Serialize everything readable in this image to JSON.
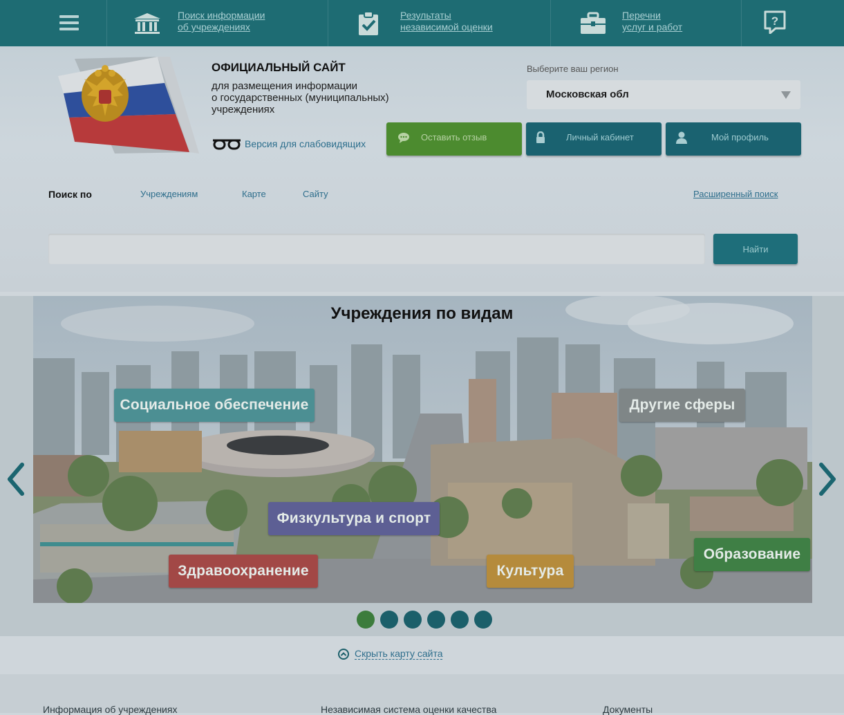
{
  "topnav": {
    "menu_icon": "hamburger-icon",
    "links": [
      {
        "line1": "Поиск информации",
        "line2": "об учреждениях",
        "icon": "institution-icon"
      },
      {
        "line1": "Результаты",
        "line2": "независимой оценки",
        "icon": "clipboard-check-icon"
      },
      {
        "line1": "Перечни",
        "line2": "услуг и работ",
        "icon": "briefcase-icon"
      }
    ],
    "help_icon": "help-question-icon"
  },
  "header": {
    "title": "ОФИЦИАЛЬНЫЙ САЙТ",
    "subtitle_lines": [
      "для размещения информации",
      "о государственных (муниципальных)",
      "учреждениях"
    ],
    "low_vision": "Версия для слабовидящих",
    "region_label": "Выберите ваш регион",
    "region_value": "Московская обл",
    "buttons": {
      "feedback": "Оставить отзыв",
      "cabinet": "Личный кабинет",
      "profile": "Мой профиль"
    }
  },
  "search": {
    "by_label": "Поиск по",
    "tabs": [
      "Учреждениям",
      "Карте",
      "Сайту"
    ],
    "advanced": "Расширенный поиск",
    "placeholder": "",
    "button": "Найти"
  },
  "carousel": {
    "title": "Учреждения по видам",
    "categories": [
      {
        "label": "Социальное обеспечение",
        "color": "#4c8f93"
      },
      {
        "label": "Другие сферы",
        "color": "#7f8687"
      },
      {
        "label": "Физкультура и спорт",
        "color": "#5d5f94"
      },
      {
        "label": "Здравоохранение",
        "color": "#a24846"
      },
      {
        "label": "Культура",
        "color": "#b58b3c"
      },
      {
        "label": "Образование",
        "color": "#3f7f45"
      }
    ],
    "dots_count": 6,
    "active_dot": 0
  },
  "hide_map": "Скрыть карту сайта",
  "footer": {
    "items": [
      "Информация об учреждениях",
      "Независимая система оценки качества",
      "Документы"
    ]
  }
}
